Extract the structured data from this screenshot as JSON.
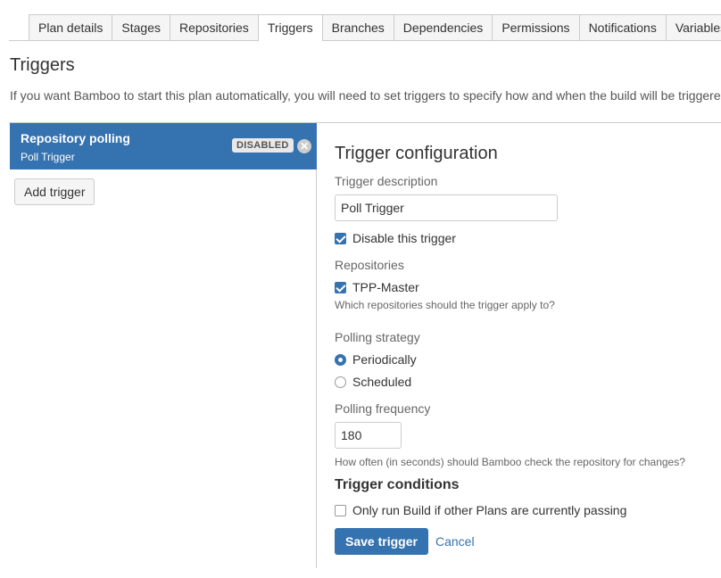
{
  "tabs": [
    {
      "label": "Plan details",
      "active": false
    },
    {
      "label": "Stages",
      "active": false
    },
    {
      "label": "Repositories",
      "active": false
    },
    {
      "label": "Triggers",
      "active": true
    },
    {
      "label": "Branches",
      "active": false
    },
    {
      "label": "Dependencies",
      "active": false
    },
    {
      "label": "Permissions",
      "active": false
    },
    {
      "label": "Notifications",
      "active": false
    },
    {
      "label": "Variables",
      "active": false
    }
  ],
  "page": {
    "title": "Triggers",
    "intro": "If you want Bamboo to start this plan automatically, you will need to set triggers to specify how and when the build will be triggered."
  },
  "trigger_list": {
    "items": [
      {
        "name": "Repository polling",
        "description": "Poll Trigger",
        "badge": "DISABLED",
        "remove_icon": "close-icon"
      }
    ],
    "add_label": "Add trigger"
  },
  "config": {
    "title": "Trigger configuration",
    "description_label": "Trigger description",
    "description_value": "Poll Trigger",
    "disable_label": "Disable this trigger",
    "disable_checked": true,
    "repositories_label": "Repositories",
    "repositories": [
      {
        "label": "TPP-Master",
        "checked": true
      }
    ],
    "repositories_help": "Which repositories should the trigger apply to?",
    "strategy_label": "Polling strategy",
    "strategies": [
      {
        "label": "Periodically",
        "selected": true
      },
      {
        "label": "Scheduled",
        "selected": false
      }
    ],
    "frequency_label": "Polling frequency",
    "frequency_value": "180",
    "frequency_help": "How often (in seconds) should Bamboo check the repository for changes?",
    "conditions_title": "Trigger conditions",
    "condition_label": "Only run Build if other Plans are currently passing",
    "condition_checked": false,
    "save_label": "Save trigger",
    "cancel_label": "Cancel"
  },
  "colors": {
    "accent": "#3572b0",
    "border": "#cccccc",
    "tab_bg": "#f5f5f5",
    "badge_bg": "#e9e9e9"
  }
}
